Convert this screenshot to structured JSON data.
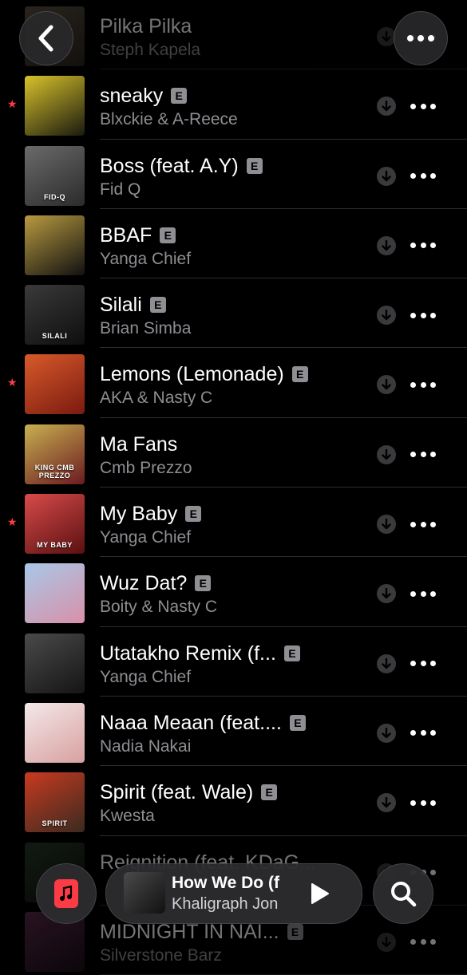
{
  "header": {
    "back_icon": "chevron-left-icon",
    "more_icon": "ellipsis-icon"
  },
  "tracks": [
    {
      "title": "Pilka Pilka",
      "artist": "Steph Kapela",
      "explicit": false,
      "favorite": false,
      "art_text": "",
      "art_colors": [
        "#5a5040",
        "#2a2520"
      ]
    },
    {
      "title": "sneaky",
      "artist": "Blxckie & A-Reece",
      "explicit": true,
      "favorite": true,
      "art_text": "",
      "art_colors": [
        "#d8c22a",
        "#1a1a10"
      ]
    },
    {
      "title": "Boss (feat. A.Y)",
      "artist": "Fid Q",
      "explicit": true,
      "favorite": false,
      "art_text": "FID-Q",
      "art_colors": [
        "#6a6a6a",
        "#2b2b2b"
      ]
    },
    {
      "title": "BBAF",
      "artist": "Yanga Chief",
      "explicit": true,
      "favorite": false,
      "art_text": "",
      "art_colors": [
        "#b89a40",
        "#111111"
      ]
    },
    {
      "title": "Silali",
      "artist": "Brian Simba",
      "explicit": true,
      "favorite": false,
      "art_text": "SILALI",
      "art_colors": [
        "#3a3a3a",
        "#0e0e0e"
      ]
    },
    {
      "title": "Lemons (Lemonade)",
      "artist": "AKA & Nasty C",
      "explicit": true,
      "favorite": true,
      "art_text": "",
      "art_colors": [
        "#d85a2a",
        "#7a1a10"
      ]
    },
    {
      "title": "Ma Fans",
      "artist": "Cmb Prezzo",
      "explicit": false,
      "favorite": false,
      "art_text": "KING CMB PREZZO",
      "art_colors": [
        "#c8b050",
        "#6a1a20"
      ]
    },
    {
      "title": "My Baby",
      "artist": "Yanga Chief",
      "explicit": true,
      "favorite": true,
      "art_text": "MY BABY",
      "art_colors": [
        "#d84a4a",
        "#5a1010"
      ]
    },
    {
      "title": "Wuz Dat?",
      "artist": "Boity & Nasty C",
      "explicit": true,
      "favorite": false,
      "art_text": "",
      "art_colors": [
        "#a8c8e8",
        "#d890a8"
      ]
    },
    {
      "title": "Utatakho Remix (f...",
      "artist": "Yanga Chief",
      "explicit": true,
      "favorite": false,
      "art_text": "",
      "art_colors": [
        "#4a4a4a",
        "#151515"
      ]
    },
    {
      "title": "Naaa Meaan (feat....",
      "artist": "Nadia Nakai",
      "explicit": true,
      "favorite": false,
      "art_text": "",
      "art_colors": [
        "#f4e8e8",
        "#d8a0a0"
      ]
    },
    {
      "title": "Spirit (feat. Wale)",
      "artist": "Kwesta",
      "explicit": true,
      "favorite": false,
      "art_text": "SPIRIT",
      "art_colors": [
        "#c83a20",
        "#3a2a20"
      ]
    },
    {
      "title": "Reignition (feat. KDaG...",
      "artist": "",
      "explicit": false,
      "favorite": false,
      "art_text": "",
      "art_colors": [
        "#2a3a2a",
        "#0e120e"
      ]
    },
    {
      "title": "MIDNIGHT IN NAI...",
      "artist": "Silverstone Barz",
      "explicit": true,
      "favorite": false,
      "art_text": "",
      "art_colors": [
        "#5a2a4a",
        "#1a0e18"
      ]
    }
  ],
  "labels": {
    "explicit_badge": "E"
  },
  "now_playing": {
    "title": "How We Do (f",
    "artist": "Khaligraph Jon"
  },
  "bottom_bar": {
    "library_icon": "music-note-icon",
    "play_icon": "play-icon",
    "search_icon": "search-icon"
  },
  "colors": {
    "accent": "#fc3c44",
    "secondary_text": "#8e8e93",
    "background": "#000000"
  }
}
